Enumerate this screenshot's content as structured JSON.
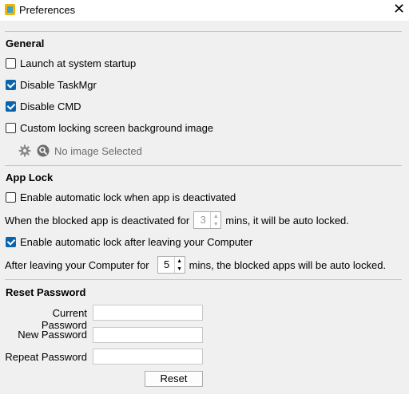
{
  "window": {
    "title": "Preferences",
    "close_glyph": "✕"
  },
  "general": {
    "heading": "General",
    "launch_startup": {
      "label": "Launch at system startup",
      "checked": false
    },
    "disable_taskmgr": {
      "label": "Disable TaskMgr",
      "checked": true
    },
    "disable_cmd": {
      "label": "Disable CMD",
      "checked": true
    },
    "custom_lock_bg": {
      "label": "Custom locking screen background image",
      "checked": false
    },
    "image_status": "No image Selected"
  },
  "app_lock": {
    "heading": "App Lock",
    "auto_lock_deactivated": {
      "label": "Enable automatic lock when app is deactivated",
      "checked": false
    },
    "deactivated_prefix": "When the blocked app is deactivated for",
    "deactivated_minutes": "3",
    "deactivated_suffix": "mins, it will be auto locked.",
    "auto_lock_leaving": {
      "label": "Enable automatic lock after leaving your Computer",
      "checked": true
    },
    "leaving_prefix": "After leaving your Computer for",
    "leaving_minutes": "5",
    "leaving_suffix": "mins, the blocked apps will be auto locked."
  },
  "reset_password": {
    "heading": "Reset Password",
    "current_label": "Current Password",
    "new_label": "New Password",
    "repeat_label": "Repeat Password",
    "current_value": "",
    "new_value": "",
    "repeat_value": "",
    "reset_button": "Reset"
  },
  "icons": {
    "settings": "gear-icon",
    "search": "search-icon",
    "close": "close-icon",
    "app": "lock-app-icon"
  },
  "colors": {
    "accent": "#0a64ad",
    "background": "#f0f0f0"
  }
}
